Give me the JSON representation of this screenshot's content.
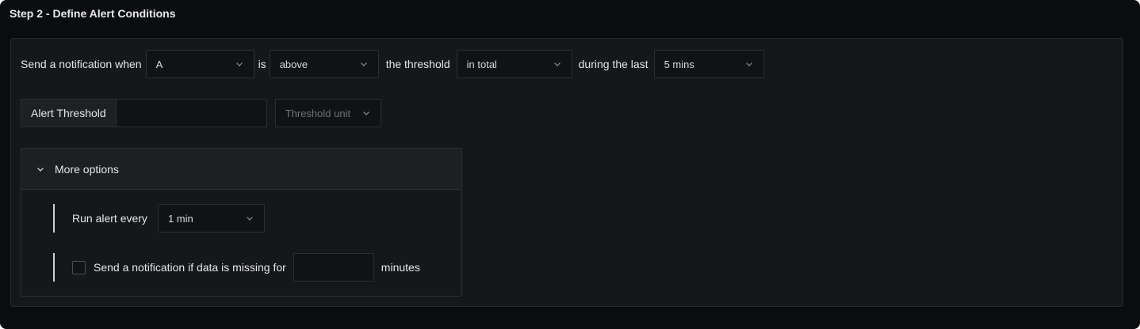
{
  "step_title": "Step 2 - Define Alert Conditions",
  "condition": {
    "prefix": "Send a notification when",
    "query": "A",
    "is_label": "is",
    "operator": "above",
    "threshold_label": "the threshold",
    "match": "in total",
    "during_label": "during the last",
    "window": "5 mins"
  },
  "threshold": {
    "label": "Alert Threshold",
    "value": "",
    "unit_placeholder": "Threshold unit"
  },
  "more_options": {
    "label": "More options",
    "run_every_label": "Run alert every",
    "run_every_value": "1 min",
    "missing_label": "Send a notification if data is missing for",
    "missing_value": "",
    "missing_unit": "minutes"
  },
  "colors": {
    "background": "#0b0c0e",
    "panel": "#161719",
    "border": "#2c2e33",
    "text": "#e4e6ea",
    "muted": "#6f737b"
  }
}
